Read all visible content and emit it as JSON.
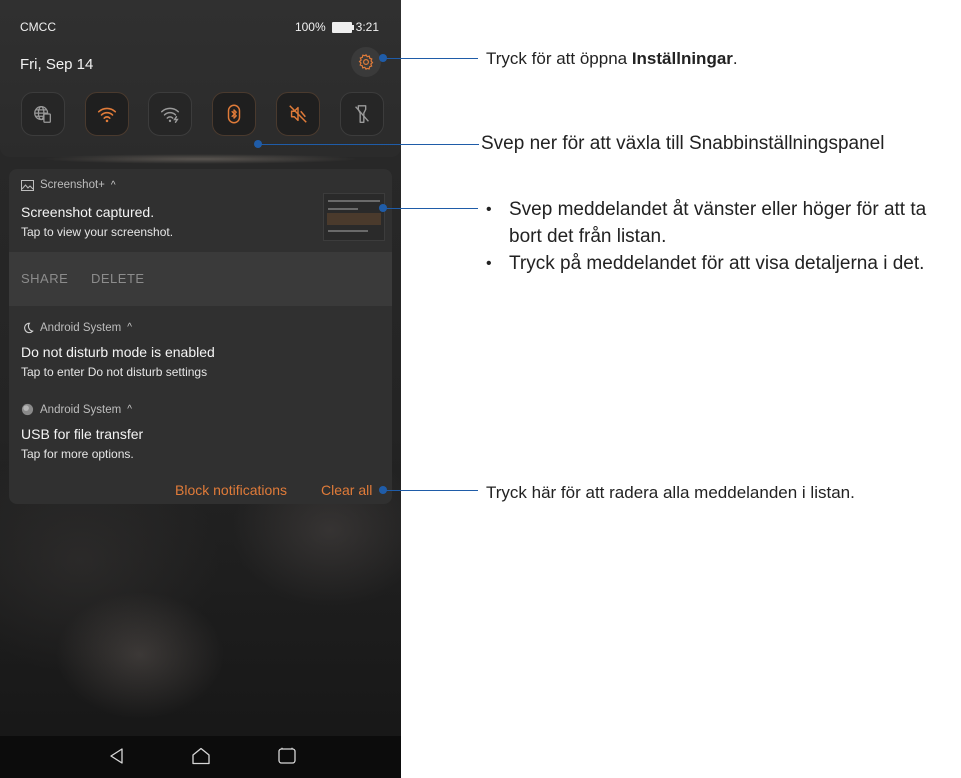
{
  "status": {
    "carrier": "CMCC",
    "battery": "100%",
    "time": "3:21"
  },
  "header": {
    "date": "Fri, Sep 14"
  },
  "quick_tiles": [
    {
      "icon": "globe-data-icon",
      "active": false
    },
    {
      "icon": "wifi-icon",
      "active": true
    },
    {
      "icon": "wifi-hotspot-icon",
      "active": false
    },
    {
      "icon": "bluetooth-icon",
      "active": true
    },
    {
      "icon": "sound-off-icon",
      "active": true
    },
    {
      "icon": "flashlight-off-icon",
      "active": false
    }
  ],
  "notifications": {
    "screenshot": {
      "app": "Screenshot+",
      "caret": "^",
      "title": "Screenshot captured.",
      "text": "Tap to view your screenshot.",
      "actions": [
        "SHARE",
        "DELETE"
      ]
    },
    "dnd": {
      "app": "Android System",
      "caret": "^",
      "title": "Do not disturb mode is enabled",
      "text": "Tap to enter Do not disturb settings"
    },
    "usb": {
      "app": "Android System",
      "caret": "^",
      "title": "USB for file transfer",
      "text": "Tap for more options."
    },
    "block_label": "Block notifications",
    "clear_label": "Clear all"
  },
  "callouts": {
    "settings_pre": "Tryck för att öppna ",
    "settings_bold": "Inställningar",
    "settings_post": ".",
    "swipe_down": "Svep ner för att växla till Snabbinställningspanel",
    "bullet_mark": "•",
    "bullets": [
      "Svep meddelandet åt vänster eller höger för att ta bort det från listan.",
      "Tryck på meddelandet för att visa detaljerna i det."
    ],
    "clear_all": "Tryck här för att radera alla meddelanden i listan."
  },
  "colors": {
    "accent": "#e07b39",
    "callout_line": "#1f5ca8"
  }
}
